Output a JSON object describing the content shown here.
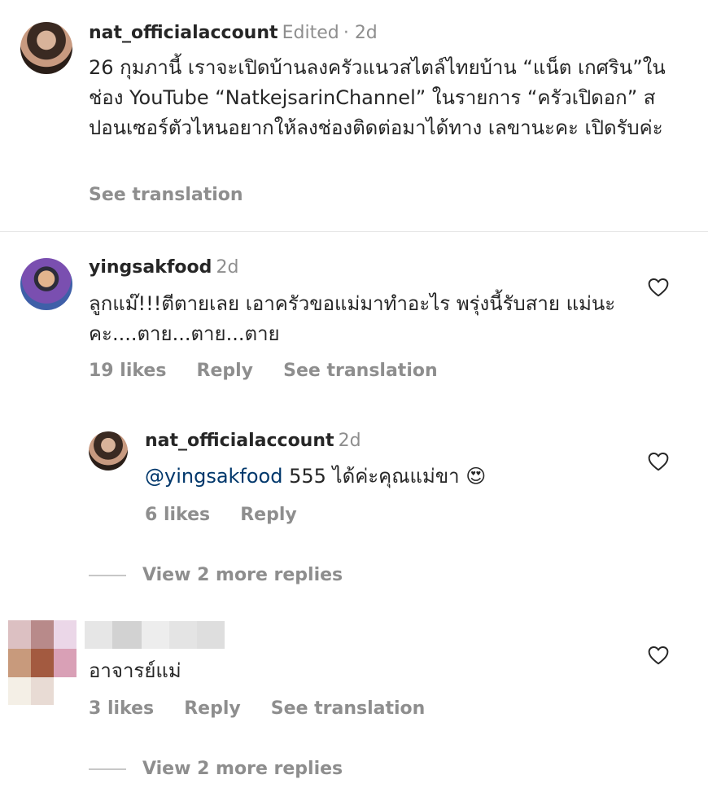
{
  "comments": [
    {
      "username": "nat_officialaccount",
      "edited": "Edited",
      "time": "· 2d",
      "text": "26 กุมภานี้ เราจะเปิดบ้านลงครัวแนวสไตล์ไทยบ้าน “แน็ต เกศริน”ในช่อง YouTube “NatkejsarinChannel” ในรายการ “ครัวเปิดอก” สปอนเซอร์ตัวไหนอยากให้ลงช่องติดต่อมาได้ทาง เลขานะคะ เปิดรับค่ะ",
      "see_translation": "See translation"
    },
    {
      "username": "yingsakfood",
      "time": "2d",
      "text": "ลูกแม๊!!!ตีตายเลย เอาครัวขอแม่มาทำอะไร พรุ่งนี้รับสาย แม่นะคะ....ตาย...ตาย...ตาย",
      "likes": "19 likes",
      "reply": "Reply",
      "see_translation": "See translation"
    },
    {
      "username": "nat_officialaccount",
      "time": "2d",
      "mention": "@yingsakfood",
      "text": " 555 ได้ค่ะคุณแม่ขา",
      "emoji": "😍",
      "likes": "6 likes",
      "reply": "Reply"
    },
    {
      "username": "",
      "text": "อาจารย์แม่",
      "likes": "3 likes",
      "reply": "Reply",
      "see_translation": "See translation"
    }
  ],
  "view_more_1": "View 2 more replies",
  "view_more_2": "View 2 more replies",
  "colors": {
    "link": "#00376b",
    "muted": "#8e8e8e",
    "text": "#262626"
  },
  "icons": {
    "like": "heart-outline-icon"
  }
}
